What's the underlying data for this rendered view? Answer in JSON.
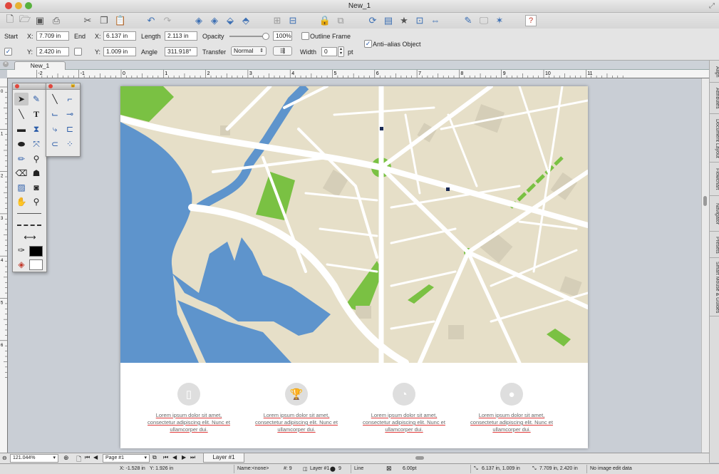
{
  "window": {
    "title": "New_1",
    "colors": {
      "close": "#e0473d",
      "minimize": "#e6b133",
      "zoom": "#58b13d",
      "accent": "#3c6fb3"
    }
  },
  "toolbar": {
    "icons": [
      "new-document-icon",
      "open-icon",
      "save-icon",
      "print-icon",
      "cut-icon",
      "copy-icon",
      "paste-icon",
      "undo-icon",
      "redo-icon",
      "bring-front-icon",
      "send-back-icon",
      "bring-forward-icon",
      "send-backward-icon",
      "group-icon",
      "ungroup-icon",
      "lock-icon",
      "unlock-icon",
      "rotate-icon",
      "window-icon",
      "star-icon",
      "snap-icon",
      "flip-icon",
      "edit-icon",
      "monitor-icon",
      "magic-icon",
      "help-icon"
    ]
  },
  "controls": {
    "start_label": "Start",
    "end_label": "End",
    "x_label": "X:",
    "y_label": "Y:",
    "start_x": "7.709 in",
    "start_y": "2.420 in",
    "end_x": "6.137 in",
    "end_y": "1.009 in",
    "length_label": "Length",
    "length": "2.113 in",
    "angle_label": "Angle",
    "angle": "311.918°",
    "opacity_label": "Opacity",
    "opacity": "100%",
    "transfer_label": "Transfer",
    "transfer": "Normal",
    "outline_frame_label": "Outline Frame",
    "antialias_label": "Anti–alias Object",
    "width_label": "Width",
    "width": "0",
    "width_unit": "pt"
  },
  "document_tab": {
    "name": "New_1"
  },
  "ruler": {
    "labels": [
      "-2",
      "-1",
      "0",
      "1",
      "2",
      "3",
      "4",
      "5",
      "6",
      "7",
      "8",
      "9",
      "10",
      "11"
    ],
    "v_labels": [
      "0",
      "1",
      "2",
      "3",
      "4",
      "5",
      "6"
    ]
  },
  "map": {
    "colors": {
      "land": "#e6dfc8",
      "water": "#5e94cc",
      "park": "#7ac143",
      "road": "#ffffff",
      "building": "#d5ceb8"
    }
  },
  "footer_items": [
    {
      "icon": "phone-icon",
      "line1": "Lorem ipsum dolor sit amet,",
      "line2": "consectetur adipiscing elit. Nunc et",
      "line3": "ullamcorper dui."
    },
    {
      "icon": "trophy-icon",
      "line1": "Lorem ipsum dolor sit amet,",
      "line2": "consectetur adipiscing elit. Nunc et",
      "line3": "ullamcorper dui."
    },
    {
      "icon": "pie-chart-icon",
      "line1": "Lorem ipsum dolor sit amet,",
      "line2": "consectetur adipiscing elit. Nunc et",
      "line3": "ullamcorper dui."
    },
    {
      "icon": "user-icon",
      "line1": "Lorem ipsum dolor sit amet,",
      "line2": "consectetur adipiscing elit. Nunc et",
      "line3": "ullamcorper dui."
    }
  ],
  "side_tabs": [
    "Align",
    "Attributes",
    "Document Layout",
    "Flowchart",
    "Navigator",
    "Presets",
    "Smart Mouse & Guides"
  ],
  "navbar": {
    "zoom": "121.044%",
    "page": "Page #1",
    "layer_tab": "Layer #1"
  },
  "status": {
    "x": "X: -1.528 in",
    "y": "Y: 1.926 in",
    "name": "Name:<none>",
    "count": "#: 9",
    "layer": "Layer #1",
    "layer_count": "9",
    "type": "Line",
    "stroke": "6.00pt",
    "start": "6.137 in, 1.009 in",
    "end": "7.709 in, 2.420 in",
    "edit_status": "No image edit data"
  }
}
